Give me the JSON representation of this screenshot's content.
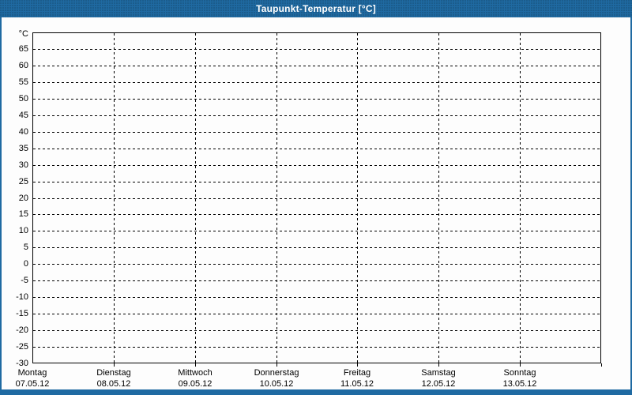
{
  "window": {
    "title": "Taupunkt-Temperatur [°C]"
  },
  "colors": {
    "accent_blue": "#1f6aa2",
    "accent_blue_dark": "#175a8c",
    "plot_border_black": "#000000",
    "grid_black": "#000000",
    "background_white": "#fdfdfd",
    "title_text_white": "#ffffff",
    "label_text_black": "#000000"
  },
  "chart_data": {
    "type": "line",
    "title": "Taupunkt-Temperatur [°C]",
    "grid": "dashed",
    "legend": "none",
    "series": [],
    "y_axis": {
      "unit_label": "°C",
      "min": -30,
      "max": 70,
      "tick_step": 5,
      "tick_labels": [
        "65",
        "60",
        "55",
        "50",
        "45",
        "40",
        "35",
        "30",
        "25",
        "20",
        "15",
        "10",
        "5",
        "0",
        "-5",
        "-10",
        "-15",
        "-20",
        "-25",
        "-30"
      ]
    },
    "x_axis": {
      "categories": [
        {
          "day": "Montag",
          "date": "07.05.12"
        },
        {
          "day": "Dienstag",
          "date": "08.05.12"
        },
        {
          "day": "Mittwoch",
          "date": "09.05.12"
        },
        {
          "day": "Donnerstag",
          "date": "10.05.12"
        },
        {
          "day": "Freitag",
          "date": "11.05.12"
        },
        {
          "day": "Samstag",
          "date": "12.05.12"
        },
        {
          "day": "Sonntag",
          "date": "13.05.12"
        }
      ]
    }
  }
}
